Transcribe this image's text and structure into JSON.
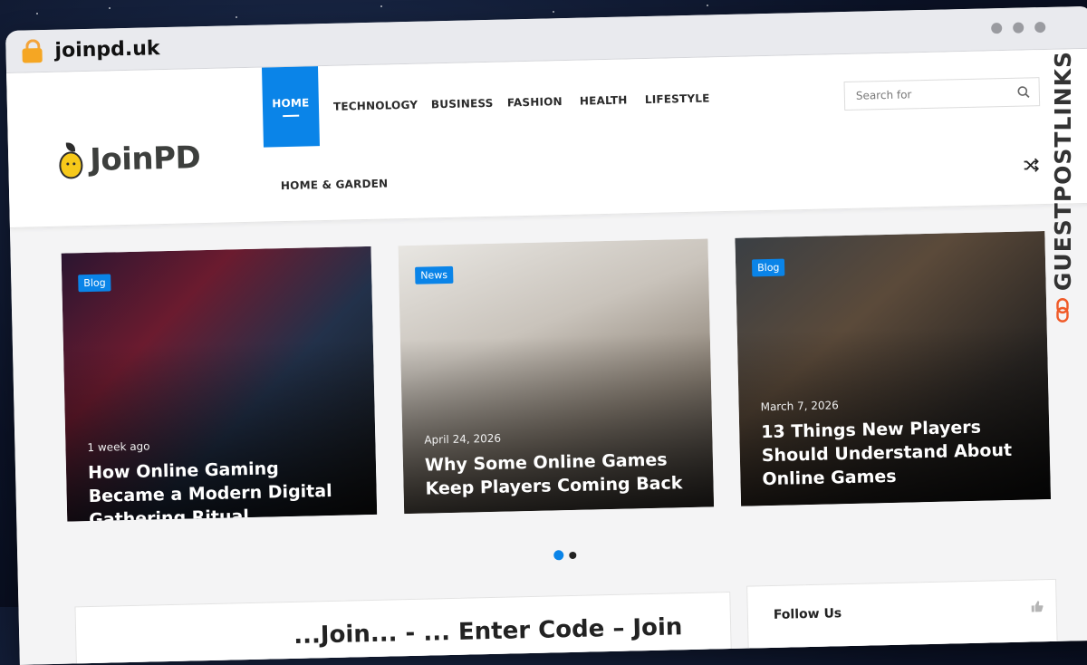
{
  "browser": {
    "url": "joinpd.uk",
    "window_controls": [
      "dot",
      "dot",
      "dot"
    ]
  },
  "site": {
    "logo_text": "JoinPD",
    "nav": [
      {
        "label": "HOME",
        "active": true
      },
      {
        "label": "TECHNOLOGY"
      },
      {
        "label": "BUSINESS"
      },
      {
        "label": "FASHION"
      },
      {
        "label": "HEALTH"
      },
      {
        "label": "LIFESTYLE"
      },
      {
        "label": "HOME & GARDEN"
      }
    ],
    "search_placeholder": "Search for",
    "icons": {
      "search": "search-icon",
      "shuffle": "shuffle-icon",
      "like": "thumbs-up-icon"
    }
  },
  "slides": [
    {
      "badge": "Blog",
      "date": "1 week ago",
      "title": "How Online Gaming Became a Modern Digital Gathering Ritual"
    },
    {
      "badge": "News",
      "date": "April 24, 2026",
      "title": "Why Some Online Games Keep Players Coming Back"
    },
    {
      "badge": "Blog",
      "date": "March 7, 2026",
      "title": "13 Things New Players Should Understand About Online Games"
    }
  ],
  "pager": {
    "count": 2,
    "active": 0
  },
  "sections": {
    "main_peek": "...Join... - ... Enter Code – Join",
    "follow_title": "Follow Us"
  },
  "brand": {
    "name": "GUESTPOSTLINKS",
    "accent": "#f05a28"
  },
  "colors": {
    "accent": "#0a84e8"
  }
}
